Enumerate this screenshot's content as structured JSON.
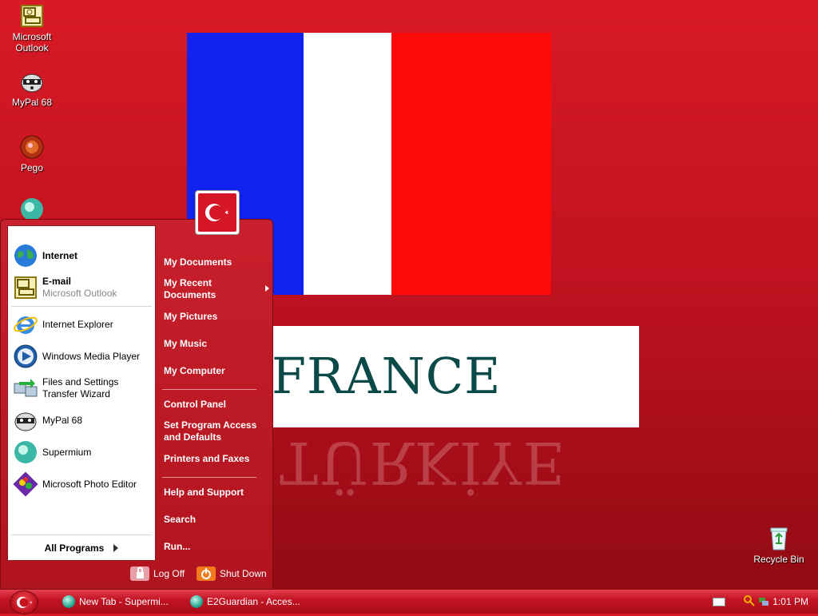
{
  "desktop": {
    "icons": [
      {
        "label": "Microsoft Outlook",
        "icon": "outlook-icon"
      },
      {
        "label": "MyPal 68",
        "icon": "mypal-icon"
      },
      {
        "label": "Pego",
        "icon": "pego-icon"
      },
      {
        "label": "Recycle Bin",
        "icon": "recycle-bin-icon"
      }
    ],
    "wallpaper_text": "FRANCE",
    "wallpaper_reflection": "TÜRKİYE",
    "colors": {
      "blue": "#1122ee",
      "white": "#ffffff",
      "red": "#ff0a0a",
      "desktop_red": "#c01220"
    }
  },
  "start_menu": {
    "left_items": [
      {
        "title": "Internet",
        "sub": "",
        "icon": "globe-icon"
      },
      {
        "title": "E-mail",
        "sub": "Microsoft Outlook",
        "icon": "outlook-icon"
      },
      {
        "title": "Internet Explorer",
        "sub": "",
        "icon": "internet-explorer-icon"
      },
      {
        "title": "Windows Media Player",
        "sub": "",
        "icon": "media-player-icon"
      },
      {
        "title": "Files and Settings Transfer Wizard",
        "sub": "",
        "icon": "transfer-wizard-icon"
      },
      {
        "title": "MyPal 68",
        "sub": "",
        "icon": "mypal-icon"
      },
      {
        "title": "Supermium",
        "sub": "",
        "icon": "supermium-icon"
      },
      {
        "title": "Microsoft Photo Editor",
        "sub": "",
        "icon": "photo-editor-icon"
      }
    ],
    "all_programs": "All Programs",
    "right_items": [
      {
        "label": "My Documents"
      },
      {
        "label": "My Recent Documents"
      },
      {
        "label": "My Pictures"
      },
      {
        "label": "My Music"
      },
      {
        "label": "My Computer"
      },
      {
        "label": "Control Panel"
      },
      {
        "label": "Set Program Access and Defaults"
      },
      {
        "label": "Printers and Faxes"
      },
      {
        "label": "Help and Support"
      },
      {
        "label": "Search"
      },
      {
        "label": "Run..."
      }
    ],
    "log_off": "Log Off",
    "shut_down": "Shut Down"
  },
  "taskbar": {
    "buttons": [
      {
        "label": "New Tab - Supermi..."
      },
      {
        "label": "E2Guardian - Acces..."
      }
    ],
    "clock": "1:01 PM"
  }
}
